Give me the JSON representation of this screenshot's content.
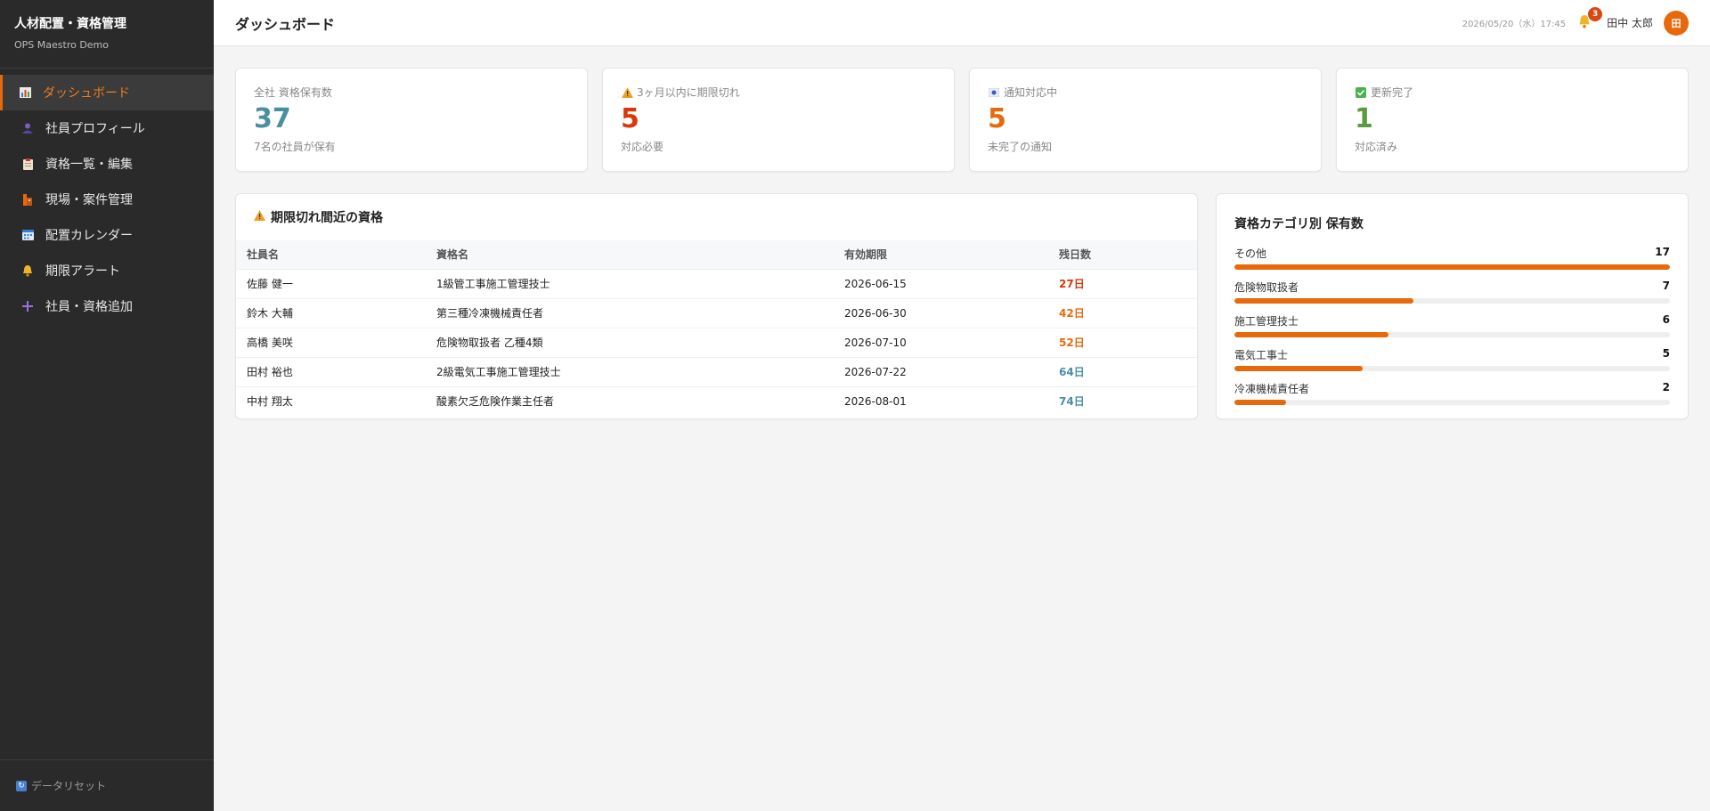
{
  "sidebar": {
    "title": "人材配置・資格管理",
    "subtitle": "OPS Maestro Demo",
    "items": [
      {
        "label": "ダッシュボード",
        "icon": "bar-chart-icon"
      },
      {
        "label": "社員プロフィール",
        "icon": "person-icon"
      },
      {
        "label": "資格一覧・編集",
        "icon": "clipboard-icon"
      },
      {
        "label": "現場・案件管理",
        "icon": "building-icon"
      },
      {
        "label": "配置カレンダー",
        "icon": "calendar-icon"
      },
      {
        "label": "期限アラート",
        "icon": "bell-icon"
      },
      {
        "label": "社員・資格追加",
        "icon": "plus-icon"
      }
    ],
    "footer_label": "データリセット"
  },
  "header": {
    "title": "ダッシュボード",
    "datetime": "2026/05/20（水）17:45",
    "notification_count": "3",
    "user_name": "田中 太郎",
    "avatar_initial": "田"
  },
  "stats": [
    {
      "label": "全社 資格保有数",
      "value": "37",
      "sub": "7名の社員が保有",
      "color": "#4a8fa0",
      "icon": ""
    },
    {
      "label": "3ヶ月以内に期限切れ",
      "value": "5",
      "sub": "対応必要",
      "color": "#d9380c",
      "icon": "warning-icon"
    },
    {
      "label": "通知対応中",
      "value": "5",
      "sub": "未完了の通知",
      "color": "#e8690c",
      "icon": "flag-icon"
    },
    {
      "label": "更新完了",
      "value": "1",
      "sub": "対応済み",
      "color": "#5a9a3c",
      "icon": "check-icon"
    }
  ],
  "expiring": {
    "title": "期限切れ間近の資格",
    "columns": [
      "社員名",
      "資格名",
      "有効期限",
      "残日数"
    ],
    "rows": [
      {
        "name": "佐藤 健一",
        "qualification": "1級管工事施工管理技士",
        "expiry": "2026-06-15",
        "days": "27日",
        "days_color": "#d9380c"
      },
      {
        "name": "鈴木 大輔",
        "qualification": "第三種冷凍機械責任者",
        "expiry": "2026-06-30",
        "days": "42日",
        "days_color": "#e8690c"
      },
      {
        "name": "高橋 美咲",
        "qualification": "危険物取扱者 乙種4類",
        "expiry": "2026-07-10",
        "days": "52日",
        "days_color": "#e8690c"
      },
      {
        "name": "田村 裕也",
        "qualification": "2級電気工事施工管理技士",
        "expiry": "2026-07-22",
        "days": "64日",
        "days_color": "#4a8fa0"
      },
      {
        "name": "中村 翔太",
        "qualification": "酸素欠乏危険作業主任者",
        "expiry": "2026-08-01",
        "days": "74日",
        "days_color": "#4a8fa0"
      }
    ]
  },
  "categories": {
    "title": "資格カテゴリ別 保有数",
    "max": 17,
    "bar_color": "#e8690c",
    "items": [
      {
        "label": "その他",
        "value": 17
      },
      {
        "label": "危険物取扱者",
        "value": 7
      },
      {
        "label": "施工管理技士",
        "value": 6
      },
      {
        "label": "電気工事士",
        "value": 5
      },
      {
        "label": "冷凍機械責任者",
        "value": 2
      }
    ]
  }
}
